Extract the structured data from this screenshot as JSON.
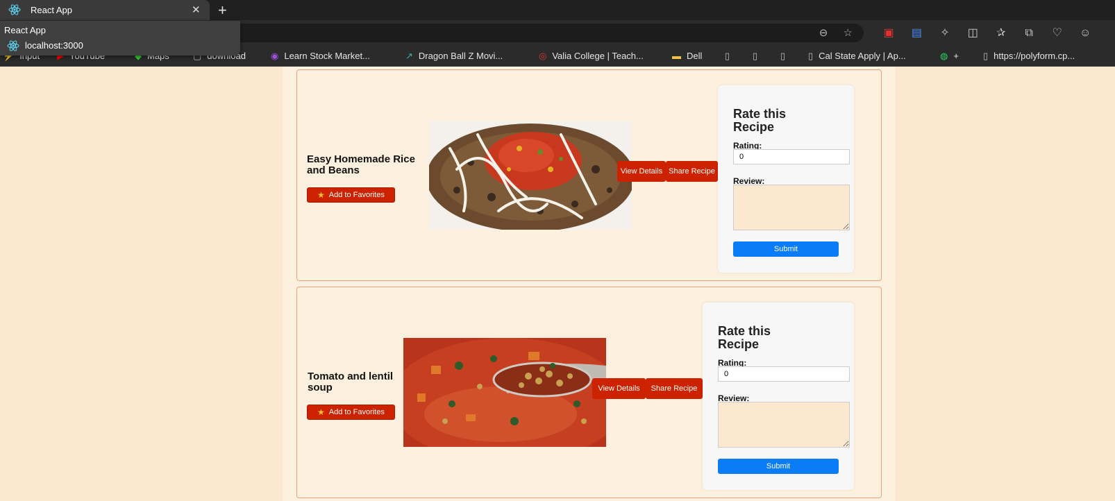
{
  "browser": {
    "tab_title": "React App",
    "close_glyph": "✕",
    "new_tab_glyph": "+",
    "tooltip_title": "React App",
    "tooltip_url": "localhost:3000",
    "bookmarks": [
      {
        "label": "Input",
        "icon": "⚡"
      },
      {
        "label": "YouTube",
        "icon": "▶"
      },
      {
        "label": "Maps",
        "icon": "◆"
      },
      {
        "label": "download",
        "icon": "▢"
      },
      {
        "label": "Learn Stock Market...",
        "icon": "◉"
      },
      {
        "label": "Dragon Ball Z Movi...",
        "icon": "↗"
      },
      {
        "label": "Valia College | Teach...",
        "icon": "◎"
      },
      {
        "label": "Dell",
        "icon": "▬"
      },
      {
        "label": "",
        "icon": "▯"
      },
      {
        "label": "",
        "icon": "▯"
      },
      {
        "label": "",
        "icon": "▯"
      },
      {
        "label": "Cal State Apply | Ap...",
        "icon": "▯"
      },
      {
        "label": "+",
        "icon": "◍"
      },
      {
        "label": "https://polyform.cp...",
        "icon": "▯"
      }
    ]
  },
  "recipes": [
    {
      "title": "Easy Homemade Rice and Beans",
      "favorite_label": "Add to Favorites",
      "view_label": "View Details",
      "share_label": "Share Recipe",
      "rate_title": "Rate this Recipe",
      "rating_label": "Rating:",
      "rating_value": "0",
      "review_label": "Review:",
      "submit_label": "Submit"
    },
    {
      "title": "Tomato and lentil soup",
      "favorite_label": "Add to Favorites",
      "view_label": "View Details",
      "share_label": "Share Recipe",
      "rate_title": "Rate this Recipe",
      "rating_label": "Rating:",
      "rating_value": "0",
      "review_label": "Review:",
      "submit_label": "Submit"
    }
  ],
  "colors": {
    "page_bg": "#fbe8cf",
    "card_bg": "#fdf0de",
    "card_border": "#e6a37a",
    "button_red": "#cc2200",
    "submit_blue": "#0a7cf5"
  }
}
